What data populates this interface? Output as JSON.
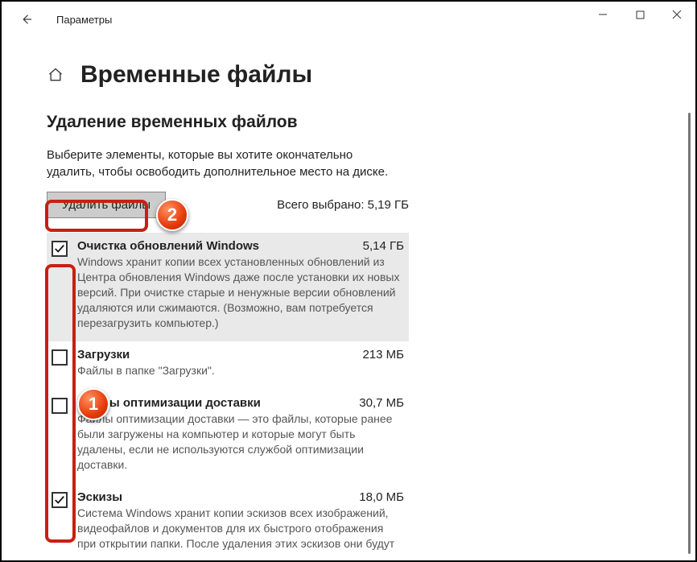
{
  "window": {
    "title": "Параметры"
  },
  "page": {
    "heading": "Временные файлы",
    "section_heading": "Удаление временных файлов",
    "intro": "Выберите элементы, которые вы хотите окончательно удалить, чтобы освободить дополнительное место на диске.",
    "delete_label": "Удалить файлы",
    "total_label": "Всего выбрано: 5,19 ГБ"
  },
  "items": [
    {
      "title": "Очистка обновлений Windows",
      "size": "5,14 ГБ",
      "checked": true,
      "desc": "Windows хранит копии всех установленных обновлений из Центра обновления Windows даже после установки их новых версий. При очистке старые и ненужные версии обновлений удаляются или сжимаются. (Возможно, вам потребуется перезагрузить компьютер.)"
    },
    {
      "title": "Загрузки",
      "size": "213 МБ",
      "checked": false,
      "desc": "Файлы в папке \"Загрузки\"."
    },
    {
      "title": "Файлы оптимизации доставки",
      "size": "30,7 МБ",
      "checked": false,
      "desc": "Файлы оптимизации доставки — это файлы, которые ранее были загружены на компьютер и которые могут быть удалены, если не используются службой оптимизации доставки."
    },
    {
      "title": "Эскизы",
      "size": "18,0 МБ",
      "checked": true,
      "desc": "Система Windows хранит копии эскизов всех изображений, видеофайлов и документов для их быстрого отображения при открытии папки. После удаления этих эскизов они будут"
    }
  ],
  "annotations": {
    "badge1": "1",
    "badge2": "2"
  }
}
